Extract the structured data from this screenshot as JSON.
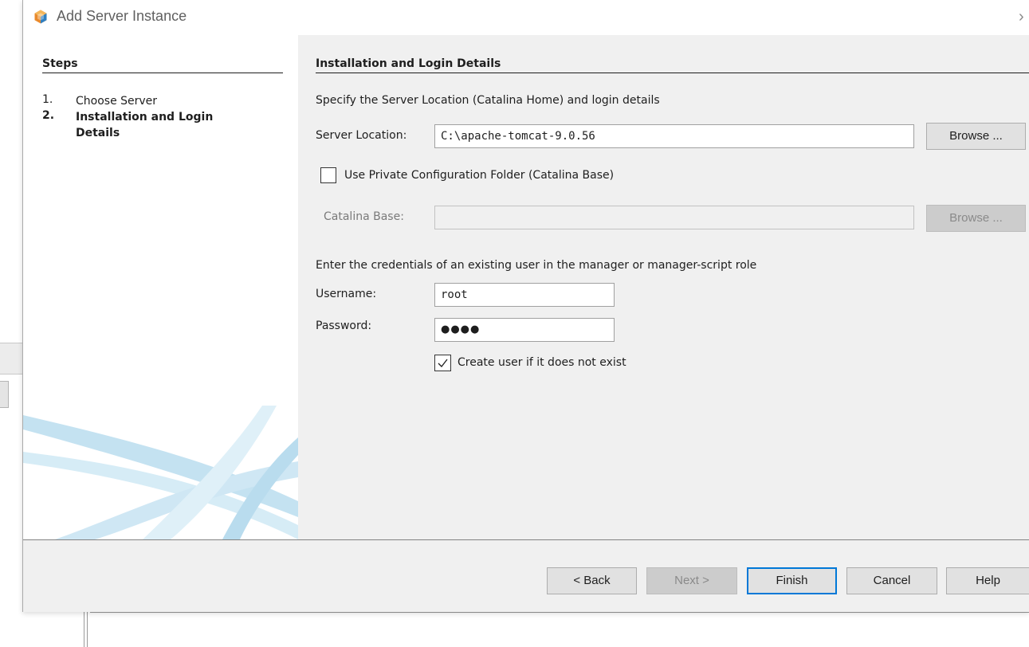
{
  "window": {
    "title": "Add Server Instance",
    "close_glyph": "›",
    "icon": "netbeans-cube-icon"
  },
  "steps": {
    "heading": "Steps",
    "items": [
      {
        "num": "1.",
        "label": "Choose Server",
        "current": false
      },
      {
        "num": "2.",
        "label": "Installation and Login Details",
        "current": true
      }
    ]
  },
  "panel": {
    "heading": "Installation and Login Details",
    "location_description": "Specify the Server Location (Catalina Home) and login details",
    "server_location": {
      "label": "Server Location:",
      "value": "C:\\apache-tomcat-9.0.56",
      "browse_label": "Browse ..."
    },
    "private_config": {
      "label": "Use Private Configuration Folder (Catalina Base)",
      "checked": false
    },
    "catalina_base": {
      "label": "Catalina Base:",
      "value": "",
      "browse_label": "Browse ...",
      "enabled": false
    },
    "credentials_description": "Enter the credentials of an existing user in the manager or manager-script role",
    "username": {
      "label": "Username:",
      "value": "root"
    },
    "password": {
      "label": "Password:",
      "masked_value": "●●●●"
    },
    "create_user": {
      "label": "Create user if it does not exist",
      "checked": true
    }
  },
  "footer": {
    "back_label": "< Back",
    "next_label": "Next >",
    "finish_label": "Finish",
    "cancel_label": "Cancel",
    "help_label": "Help"
  },
  "colors": {
    "panel_bg": "#f0f0f0",
    "button_bg": "#e1e1e1",
    "default_button_border": "#0078d7",
    "disabled_text": "#8a8a8a",
    "swoosh_blue": "#bfe0f0"
  }
}
